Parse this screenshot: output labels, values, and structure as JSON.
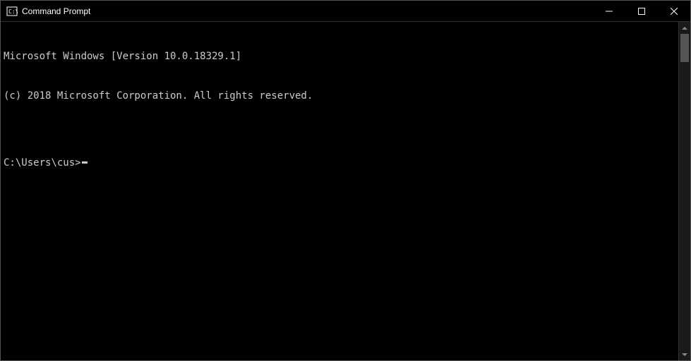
{
  "titlebar": {
    "title": "Command Prompt"
  },
  "terminal": {
    "line1": "Microsoft Windows [Version 10.0.18329.1]",
    "line2": "(c) 2018 Microsoft Corporation. All rights reserved.",
    "blank": "",
    "prompt": "C:\\Users\\cus>"
  }
}
